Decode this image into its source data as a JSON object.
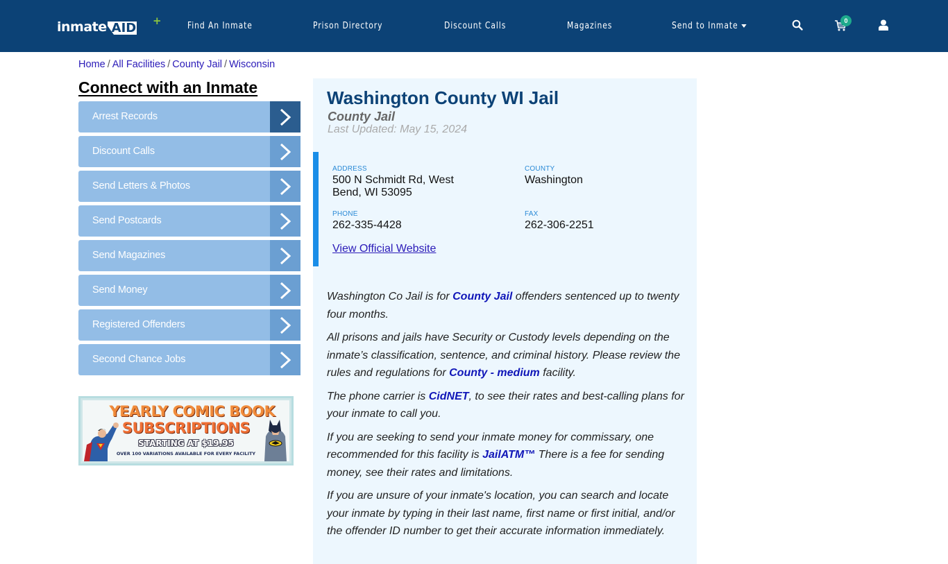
{
  "header": {
    "logo_text": "inmate",
    "logo_aid": "AID",
    "logo_plus": "+",
    "nav": [
      {
        "label": "Find An Inmate"
      },
      {
        "label": "Prison Directory"
      },
      {
        "label": "Discount Calls"
      },
      {
        "label": "Magazines"
      },
      {
        "label": "Send to Inmate",
        "has_dropdown": true
      }
    ],
    "cart_count": "0"
  },
  "breadcrumb": [
    {
      "label": "Home"
    },
    {
      "label": "All Facilities"
    },
    {
      "label": "County Jail"
    },
    {
      "label": "Wisconsin"
    }
  ],
  "breadcrumb_separator": "/",
  "sidebar": {
    "title": "Connect with an Inmate",
    "items": [
      {
        "label": "Arrest Records",
        "active": true
      },
      {
        "label": "Discount Calls"
      },
      {
        "label": "Send Letters & Photos"
      },
      {
        "label": "Send Postcards"
      },
      {
        "label": "Send Magazines"
      },
      {
        "label": "Send Money"
      },
      {
        "label": "Registered Offenders"
      },
      {
        "label": "Second Chance Jobs"
      }
    ],
    "banner": {
      "line1": "YEARLY COMIC BOOK",
      "line2": "SUBSCRIPTIONS",
      "line3": "STARTING AT $19.95",
      "line4": "OVER 100 VARIATIONS AVAILABLE FOR EVERY FACILITY"
    }
  },
  "facility": {
    "title": "Washington County WI Jail",
    "type": "County Jail",
    "last_updated": "Last Updated: May 15, 2024",
    "address_label": "ADDRESS",
    "address": "500 N Schmidt Rd, West Bend, WI 53095",
    "county_label": "COUNTY",
    "county": "Washington",
    "phone_label": "PHONE",
    "phone": "262-335-4428",
    "fax_label": "FAX",
    "fax": "262-306-2251",
    "website_link": "View Official Website"
  },
  "description": {
    "p1": {
      "before": "Washington Co Jail is for ",
      "link": "County Jail",
      "after": " offenders sentenced up to twenty four months."
    },
    "p2": {
      "before": "All prisons and jails have Security or Custody levels depending on the inmate’s classification, sentence, and criminal history. Please review the rules and regulations for ",
      "link": "County - medium",
      "after": " facility."
    },
    "p3": {
      "before": "The phone carrier is ",
      "link": "CidNET",
      "after": ", to see their rates and best-calling plans for your inmate to call you."
    },
    "p4": {
      "before": "If you are seeking to send your inmate money for commissary, one recommended for this facility is ",
      "link": "JailATM™",
      "after": " There is a fee for sending money, see their rates and limitations."
    },
    "p5": {
      "text": "If you are unsure of your inmate's location, you can search and locate your inmate by typing in their last name, first name or first initial, and/or the offender ID number to get their accurate information immediately."
    }
  },
  "colors": {
    "header_bg": "#0c4276",
    "menu_bg": "#93bde6",
    "menu_arrow_bg": "#6b9fd2",
    "menu_arrow_active_bg": "#2b5d8f",
    "main_bg": "#edf7fe",
    "accent_border": "#1a8ee8",
    "badge": "#1eaa8c"
  }
}
